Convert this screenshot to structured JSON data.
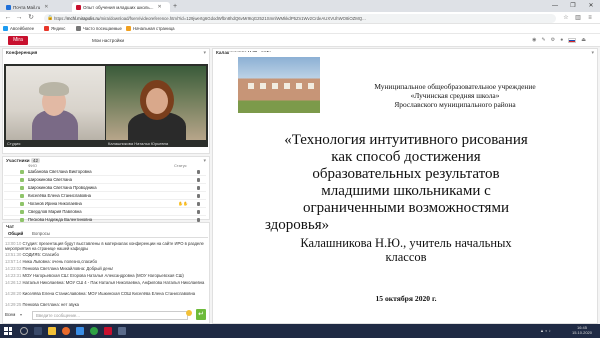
{
  "browser": {
    "tabs": [
      {
        "label": "Почта Mail.ru",
        "color": "#1e6fd9",
        "active": false
      },
      {
        "label": "Опыт обучения младших школь...",
        "color": "#c8102e",
        "active": true
      }
    ],
    "new_tab_glyph": "+",
    "window_controls": [
      "—",
      "❐",
      "✕"
    ],
    "url_prefix": "https://",
    "url_host": "mchl.mirapolis.ru",
    "url_rest": "/mira/download/fserv/videoreference.html?id=129jwertg6GdodWfbn8hdQ6vMr9IqG2521SmnlWMkkdP5Zn1Wv2CrdeAUXVUhWO8iOZMQ...",
    "bookmarks": [
      {
        "label": "Авсейбилее",
        "color": "#1d9bf0"
      },
      {
        "label": "Яндекс",
        "color": "#e8362a"
      },
      {
        "label": "Часто посещаемые",
        "color": "#777777"
      },
      {
        "label": "Начальная страница",
        "color": "#f0a020"
      }
    ]
  },
  "app": {
    "logo_text": "Mira",
    "menu_label": "Мои настройки"
  },
  "conference": {
    "title": "Конференция",
    "cam_labels": [
      "Студия",
      "Калашникова Наталья Юрьевна"
    ]
  },
  "participants": {
    "title": "Участники",
    "count": "42",
    "col_name": "ФИО",
    "col_status": "Статус",
    "rows": [
      "Шабанова Светлана Викторовна",
      "Широкинова Светлана",
      "Широкинова Светлана Проводника",
      "Киселёва Елена Станиславовна",
      "Чоганов Ирина Николаевна",
      "Свердлов Мария Павловна",
      "Пескова Надежда Валентиновна"
    ]
  },
  "chat": {
    "title": "Чат",
    "tabs": [
      "Общий",
      "Вопросы"
    ],
    "lines": [
      {
        "t": "13:00:10",
        "u": "Студия:",
        "m": "презентация будут выставлены в материалах конференции на сайте ИРО в разделе мероприятия на странице нашей кафедры"
      },
      {
        "t": "13:51:30",
        "u": "СОДИЯ5:",
        "m": "Спасибо"
      },
      {
        "t": "13:57:14",
        "u": "Ника Львовна:",
        "m": "очень полезно,спасибо"
      },
      {
        "t": "14:23:02",
        "u": "Пенкова Светлана Михайловна:",
        "m": "Добрый день!"
      },
      {
        "t": "14:23:31",
        "u": "МОУ Нагорьевская СШ:",
        "m": "Егорова Наталья Александровна (МОУ Нагорьевская СШ)"
      },
      {
        "t": "14:26:12",
        "u": "Наталья Николаевна:",
        "m": "МОУ СШ 4 - Пак Наталья Николаевна, Анфилова Наталья Николаевна"
      },
      {
        "t": "14:28:20",
        "u": "Киселёва Елена Станиславовна:",
        "m": "МОУ Ишкинская СОШ Киселёва Елена Станиславовна"
      },
      {
        "t": "14:29:25",
        "u": "Пенкова Светлана:",
        "m": "нет звука"
      }
    ],
    "input_placeholder": "Введите сообщение...",
    "scope_label": "Всем",
    "send_glyph": "↵"
  },
  "presenter": {
    "title": "Калашникова Н.Ю., pptx",
    "slide": {
      "institution_1": "Муниципальное общеобразовательное учреждение",
      "institution_2": "«Лучинская средняя школа»",
      "institution_3": "Ярославского муниципального района",
      "title_1": "«Технология интуитивного рисования",
      "title_2": "как способ достижения",
      "title_3": "образовательных результатов",
      "title_4": "младшими школьниками с",
      "title_5": "ограниченными возможностями",
      "title_6": "здоровья»",
      "author_1": "Калашникова Н.Ю., учитель начальных",
      "author_2": "классов",
      "date": "15 октября 2020 г."
    }
  },
  "taskbar": {
    "time": "16:45",
    "date": "15.10.2020"
  },
  "colors": {
    "accent": "#c8102e",
    "taskbar": "#1f2a44",
    "send": "#6dbb3a"
  }
}
